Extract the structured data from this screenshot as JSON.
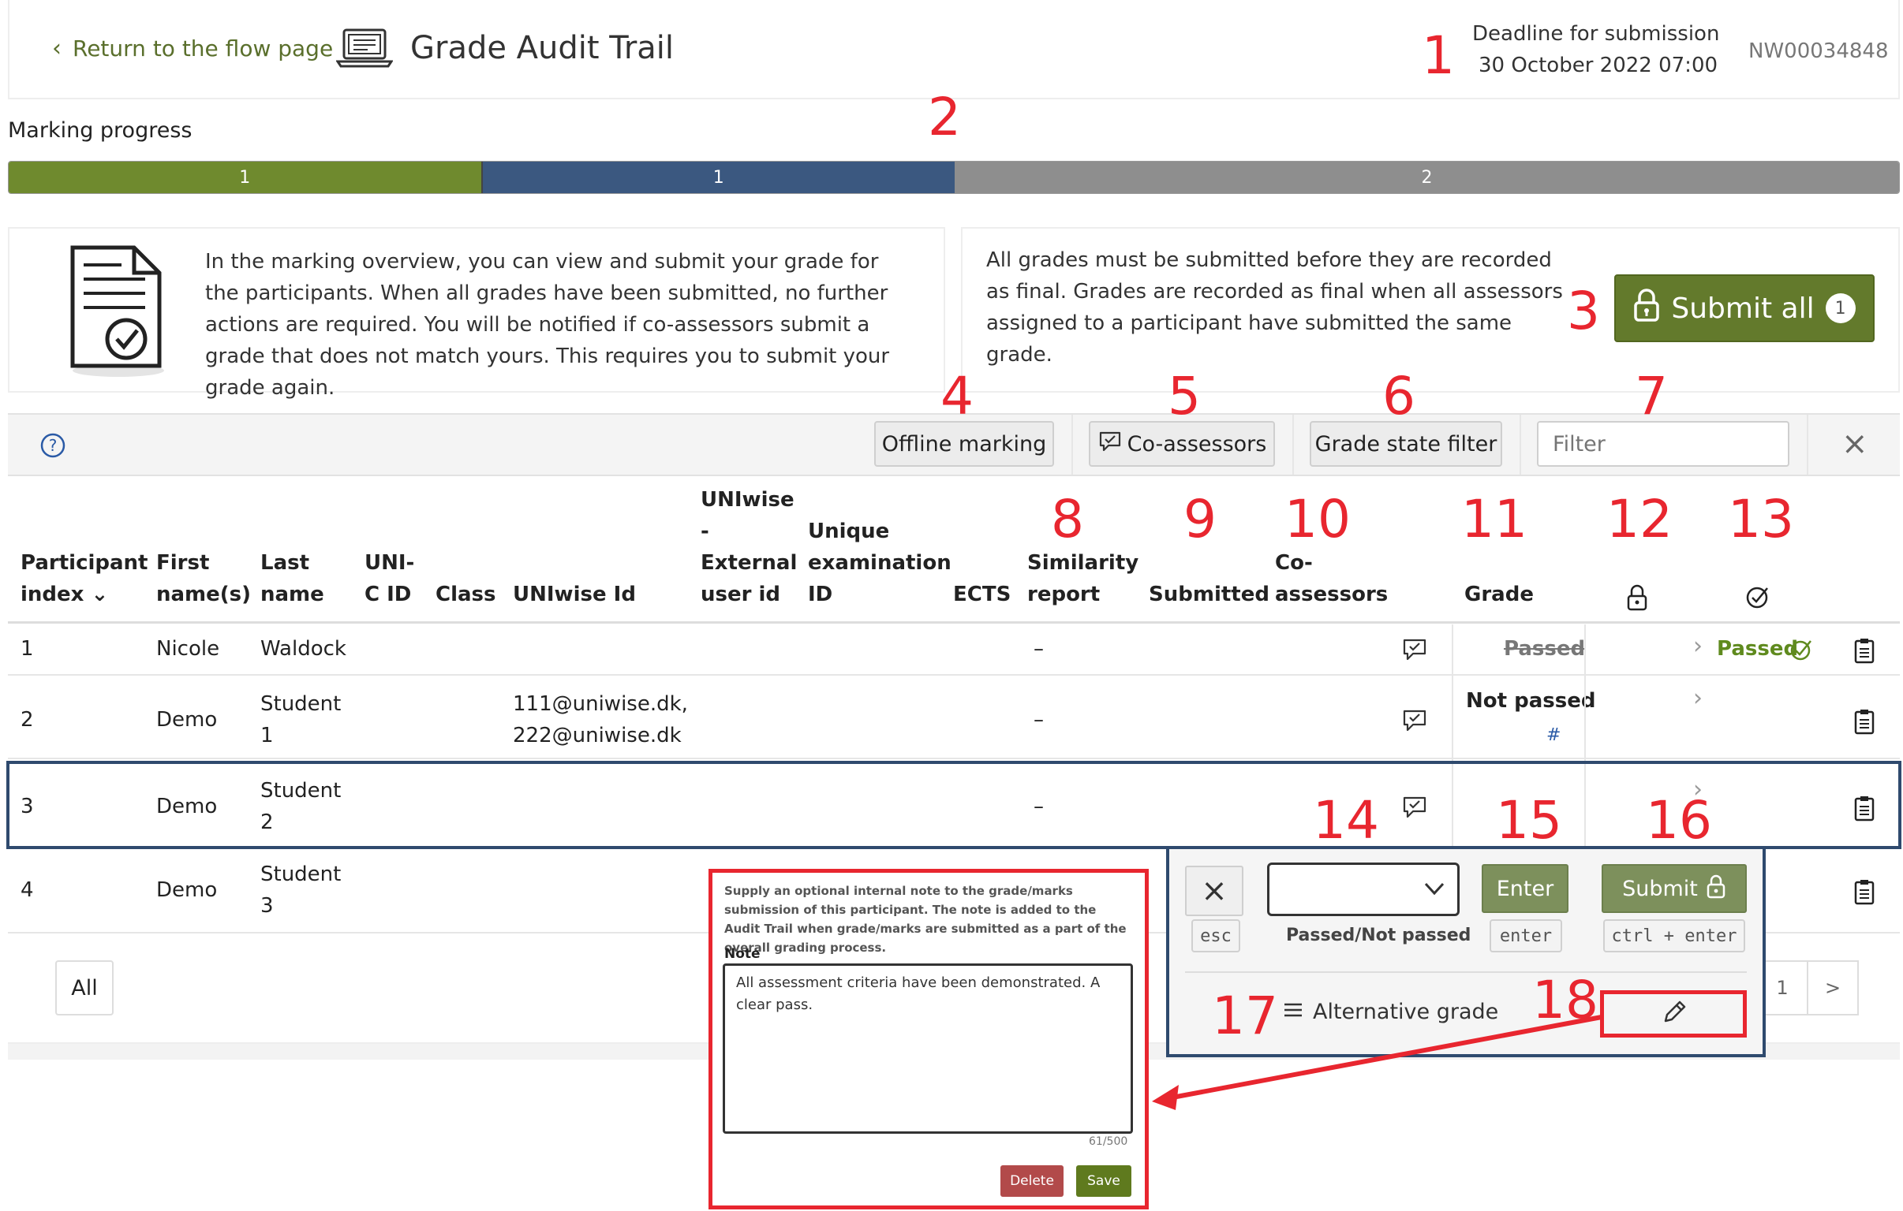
{
  "header": {
    "back_link": "Return to the flow page",
    "title": "Grade Audit Trail",
    "deadline_label": "Deadline for submission",
    "deadline_value": "30 October 2022 07:00",
    "flow_id": "NW00034848"
  },
  "progress": {
    "label": "Marking progress",
    "segments": [
      {
        "value": "1",
        "fraction": 0.25,
        "color": "#6f8a2e"
      },
      {
        "value": "1",
        "fraction": 0.25,
        "color": "#3b5880"
      },
      {
        "value": "2",
        "fraction": 0.5,
        "color": "#8e8e8e"
      }
    ]
  },
  "info": {
    "text": "In the marking overview, you can view and submit your grade for the participants. When all grades have been submitted, no further actions are required. You will be notified if co-assessors submit a grade that does not match yours. This requires you to submit your grade again.",
    "final_text": "All grades must be submitted before they are recorded as final. Grades are recorded as final when all assessors assigned to a participant have submitted the same grade.",
    "submit_all_label": "Submit all",
    "submit_all_count": "1"
  },
  "toolbar": {
    "offline_marking": "Offline marking",
    "co_assessors": "Co-assessors",
    "grade_state_filter": "Grade state filter",
    "filter_placeholder": "Filter",
    "close": "×"
  },
  "table": {
    "headers": {
      "participant_index_1": "Participant",
      "participant_index_2": "index",
      "first_1": "First",
      "first_2": "name(s)",
      "last_1": "Last",
      "last_2": "name",
      "unicid_1": "UNI-",
      "unicid_2": "C ID",
      "class": "Class",
      "uniwise_id": "UNIwise Id",
      "ext_1": "UNIwise",
      "ext_2": "-",
      "ext_3": "External",
      "ext_4": "user id",
      "exam_1": "Unique",
      "exam_2": "examination",
      "exam_3": "ID",
      "ects": "ECTS",
      "sim_1": "Similarity",
      "sim_2": "report",
      "submitted": "Submitted",
      "co_1": "Co-",
      "co_2": "assessors",
      "grade": "Grade"
    },
    "rows": [
      {
        "index": "1",
        "first": "Nicole",
        "last_1": "Waldock",
        "last_2": "",
        "uniwise": "",
        "uniwise_2": "",
        "similarity": "–",
        "grade": "Passed",
        "grade_sub": "",
        "final": "Passed"
      },
      {
        "index": "2",
        "first": "Demo",
        "last_1": "Student",
        "last_2": "1",
        "uniwise": "111@uniwise.dk,",
        "uniwise_2": "222@uniwise.dk",
        "similarity": "–",
        "grade": "Not passed",
        "grade_sub": "#",
        "final": ""
      },
      {
        "index": "3",
        "first": "Demo",
        "last_1": "Student",
        "last_2": "2",
        "uniwise": "",
        "uniwise_2": "",
        "similarity": "–",
        "grade": "",
        "grade_sub": "",
        "final": ""
      },
      {
        "index": "4",
        "first": "Demo",
        "last_1": "Student",
        "last_2": "3",
        "uniwise": "",
        "uniwise_2": "",
        "similarity": "",
        "grade": "",
        "grade_sub": "",
        "final": ""
      }
    ]
  },
  "pagination": {
    "all_label": "All",
    "page": "1",
    "next": ">"
  },
  "grade_popup": {
    "cancel": "×",
    "esc": "esc",
    "select_caption": "Passed/Not passed",
    "enter": "Enter",
    "enter_key": "enter",
    "submit": "Submit",
    "submit_key": "ctrl + enter",
    "alternative_grade": "Alternative grade"
  },
  "note_popup": {
    "description": "Supply an optional internal note to the grade/marks submission of this participant. The note is added to the Audit Trail when grade/marks are submitted as a part of the overall grading process.",
    "label": "Note",
    "value": "All assessment criteria have been demonstrated. A clear pass.",
    "counter": "61/500",
    "delete": "Delete",
    "save": "Save"
  },
  "annotations": [
    "1",
    "2",
    "3",
    "4",
    "5",
    "6",
    "7",
    "8",
    "9",
    "10",
    "11",
    "12",
    "13",
    "14",
    "15",
    "16",
    "17",
    "18"
  ],
  "colors": {
    "olive": "#6f8a2e",
    "navy": "#2f4a6e",
    "annotation_red": "#e8262f",
    "passed_green": "#5f8a1e"
  }
}
